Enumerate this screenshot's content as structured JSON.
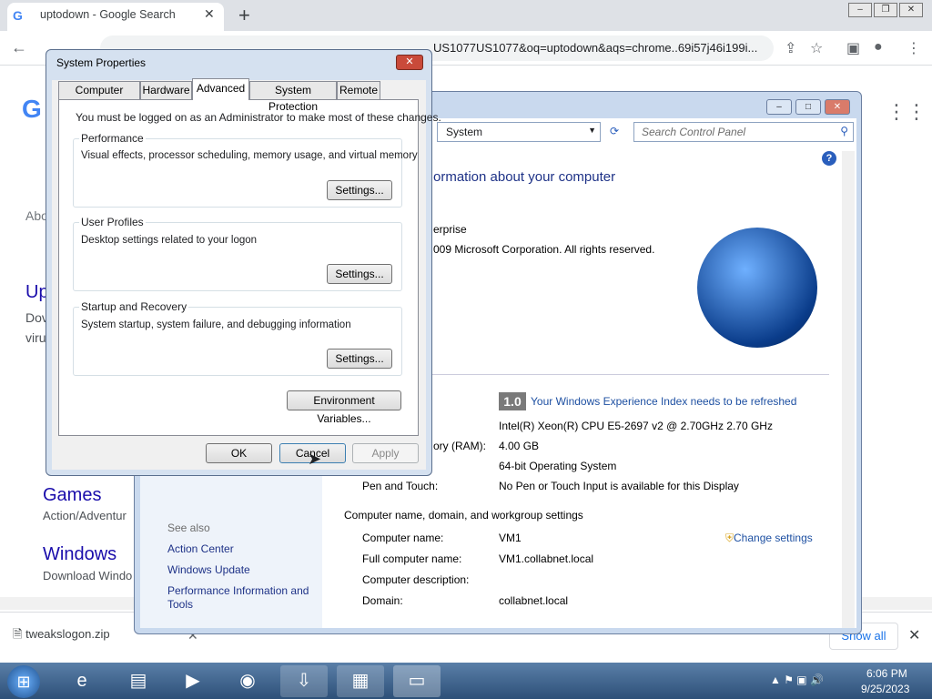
{
  "browser": {
    "tab_title": "uptodown - Google Search",
    "tab_favicon": "G",
    "url": "US1077US1077&oq=uptodown&aqs=chrome..69i57j46i199i...",
    "new_tab": "+"
  },
  "page": {
    "logo": "G",
    "about": "Abo",
    "result_title": "Up",
    "result_snip1": "Dov",
    "result_snip2": "viru",
    "games_title": "Games",
    "games_sub": "Action/Adventur",
    "windows_title": "Windows",
    "windows_sub": "Download Windo"
  },
  "downloads": {
    "file": "tweakslogon.zip",
    "show_all": "Show all"
  },
  "system": {
    "address": "System",
    "search_placeholder": "Search Control Panel",
    "heading": "ormation about your computer",
    "edition": "erprise",
    "copyright": "009 Microsoft Corporation.  All rights reserved.",
    "rating_badge": "1.0",
    "rating_link": "Your Windows Experience Index needs to be refreshed",
    "processor": "Intel(R) Xeon(R) CPU E5-2697 v2 @ 2.70GHz   2.70 GHz",
    "ram_label": "ory (RAM):",
    "ram_value": "4.00 GB",
    "system_type": "64-bit Operating System",
    "pen_label": "Pen and Touch:",
    "pen_value": "No Pen or Touch Input is available for this Display",
    "section_computer": "Computer name, domain, and workgroup settings",
    "cn_label": "Computer name:",
    "cn_value": "VM1",
    "fcn_label": "Full computer name:",
    "fcn_value": "VM1.collabnet.local",
    "desc_label": "Computer description:",
    "domain_label": "Domain:",
    "domain_value": "collabnet.local",
    "change_settings": "Change settings",
    "see_also": "See also",
    "links": [
      "Action Center",
      "Windows Update",
      "Performance Information and",
      "Tools"
    ]
  },
  "dialog": {
    "title": "System Properties",
    "tabs": [
      "Computer Name",
      "Hardware",
      "Advanced",
      "System Protection",
      "Remote"
    ],
    "admin_note": "You must be logged on as an Administrator to make most of these changes.",
    "perf_title": "Performance",
    "perf_desc": "Visual effects, processor scheduling, memory usage, and virtual memory",
    "profiles_title": "User Profiles",
    "profiles_desc": "Desktop settings related to your logon",
    "startup_title": "Startup and Recovery",
    "startup_desc": "System startup, system failure, and debugging information",
    "settings_btn": "Settings...",
    "env_btn": "Environment Variables...",
    "ok": "OK",
    "cancel": "Cancel",
    "apply": "Apply"
  },
  "taskbar": {
    "time": "6:06 PM",
    "date": "9/25/2023"
  }
}
